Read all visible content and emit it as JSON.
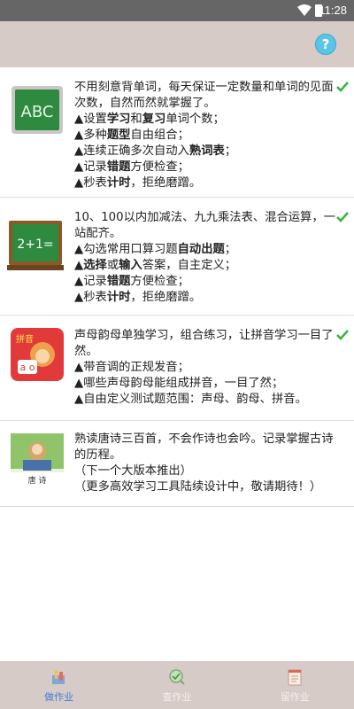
{
  "status_bar": {
    "time": "11:28"
  },
  "header": {
    "help_label": "?"
  },
  "items": [
    {
      "thumb": "abc-chalkboard-image",
      "lines": [
        [
          {
            "t": "不用刻意背单词，每天保证一定数量和单词的见面次数，自然而然就掌握了。",
            "b": false
          }
        ],
        [
          {
            "t": "▲设置",
            "b": false
          },
          {
            "t": "学习",
            "b": true
          },
          {
            "t": "和",
            "b": false
          },
          {
            "t": "复习",
            "b": true
          },
          {
            "t": "单词个数；",
            "b": false
          }
        ],
        [
          {
            "t": "▲多种",
            "b": false
          },
          {
            "t": "题型",
            "b": true
          },
          {
            "t": "自由组合；",
            "b": false
          }
        ],
        [
          {
            "t": "▲连续正确多次自动入",
            "b": false
          },
          {
            "t": "熟词表",
            "b": true
          },
          {
            "t": "；",
            "b": false
          }
        ],
        [
          {
            "t": "▲记录",
            "b": false
          },
          {
            "t": "错题",
            "b": true
          },
          {
            "t": "方便检查；",
            "b": false
          }
        ],
        [
          {
            "t": "▲秒表",
            "b": false
          },
          {
            "t": "计时",
            "b": true
          },
          {
            "t": "，拒绝磨蹭。",
            "b": false
          }
        ]
      ],
      "checked": true
    },
    {
      "thumb": "math-chalkboard-image",
      "lines": [
        [
          {
            "t": "10、100以内加减法、九九乘法表、混合运算，一站配齐。",
            "b": false
          }
        ],
        [
          {
            "t": "▲勾选常用口算习题",
            "b": false
          },
          {
            "t": "自动出题",
            "b": true
          },
          {
            "t": "；",
            "b": false
          }
        ],
        [
          {
            "t": "▲",
            "b": false
          },
          {
            "t": "选择",
            "b": true
          },
          {
            "t": "或",
            "b": false
          },
          {
            "t": "输入",
            "b": true
          },
          {
            "t": "答案，自主定义；",
            "b": false
          }
        ],
        [
          {
            "t": "▲记录",
            "b": false
          },
          {
            "t": "错题",
            "b": true
          },
          {
            "t": "方便检查；",
            "b": false
          }
        ],
        [
          {
            "t": "▲秒表",
            "b": false
          },
          {
            "t": "计时",
            "b": true
          },
          {
            "t": "，拒绝磨蹭。",
            "b": false
          }
        ]
      ],
      "checked": true
    },
    {
      "thumb": "pinyin-monkey-image",
      "thumb_text": "拼音",
      "lines": [
        [
          {
            "t": "声母韵母单独学习，组合练习，让拼音学习一目了然。",
            "b": false
          }
        ],
        [
          {
            "t": "▲带音调的正规发音；",
            "b": false
          }
        ],
        [
          {
            "t": "▲哪些声母韵母能组成拼音，一目了然；",
            "b": false
          }
        ],
        [
          {
            "t": "▲自由定义测试题范围：声母、韵母、拼音。",
            "b": false
          }
        ]
      ],
      "checked": true
    },
    {
      "thumb": "tang-poetry-book-image",
      "thumb_text": "唐 诗",
      "lines": [
        [
          {
            "t": "熟读唐诗三百首，不会作诗也会吟。记录掌握古诗的历程。",
            "b": false
          }
        ],
        [
          {
            "t": "（下一个大版本推出）",
            "b": false
          }
        ],
        [
          {
            "t": "（更多高效学习工具陆续设计中，敬请期待！）",
            "b": false
          }
        ]
      ],
      "checked": false
    }
  ],
  "tabs": [
    {
      "label": "做作业",
      "icon": "pencil-tools-icon",
      "active": true
    },
    {
      "label": "查作业",
      "icon": "magnifier-icon",
      "active": false
    },
    {
      "label": "留作业",
      "icon": "notepad-icon",
      "active": false
    }
  ],
  "colors": {
    "header_bg": "#d7cbc8",
    "tab_active": "#4a7bd1",
    "check": "#3cb043",
    "help": "#5bc5e8"
  }
}
